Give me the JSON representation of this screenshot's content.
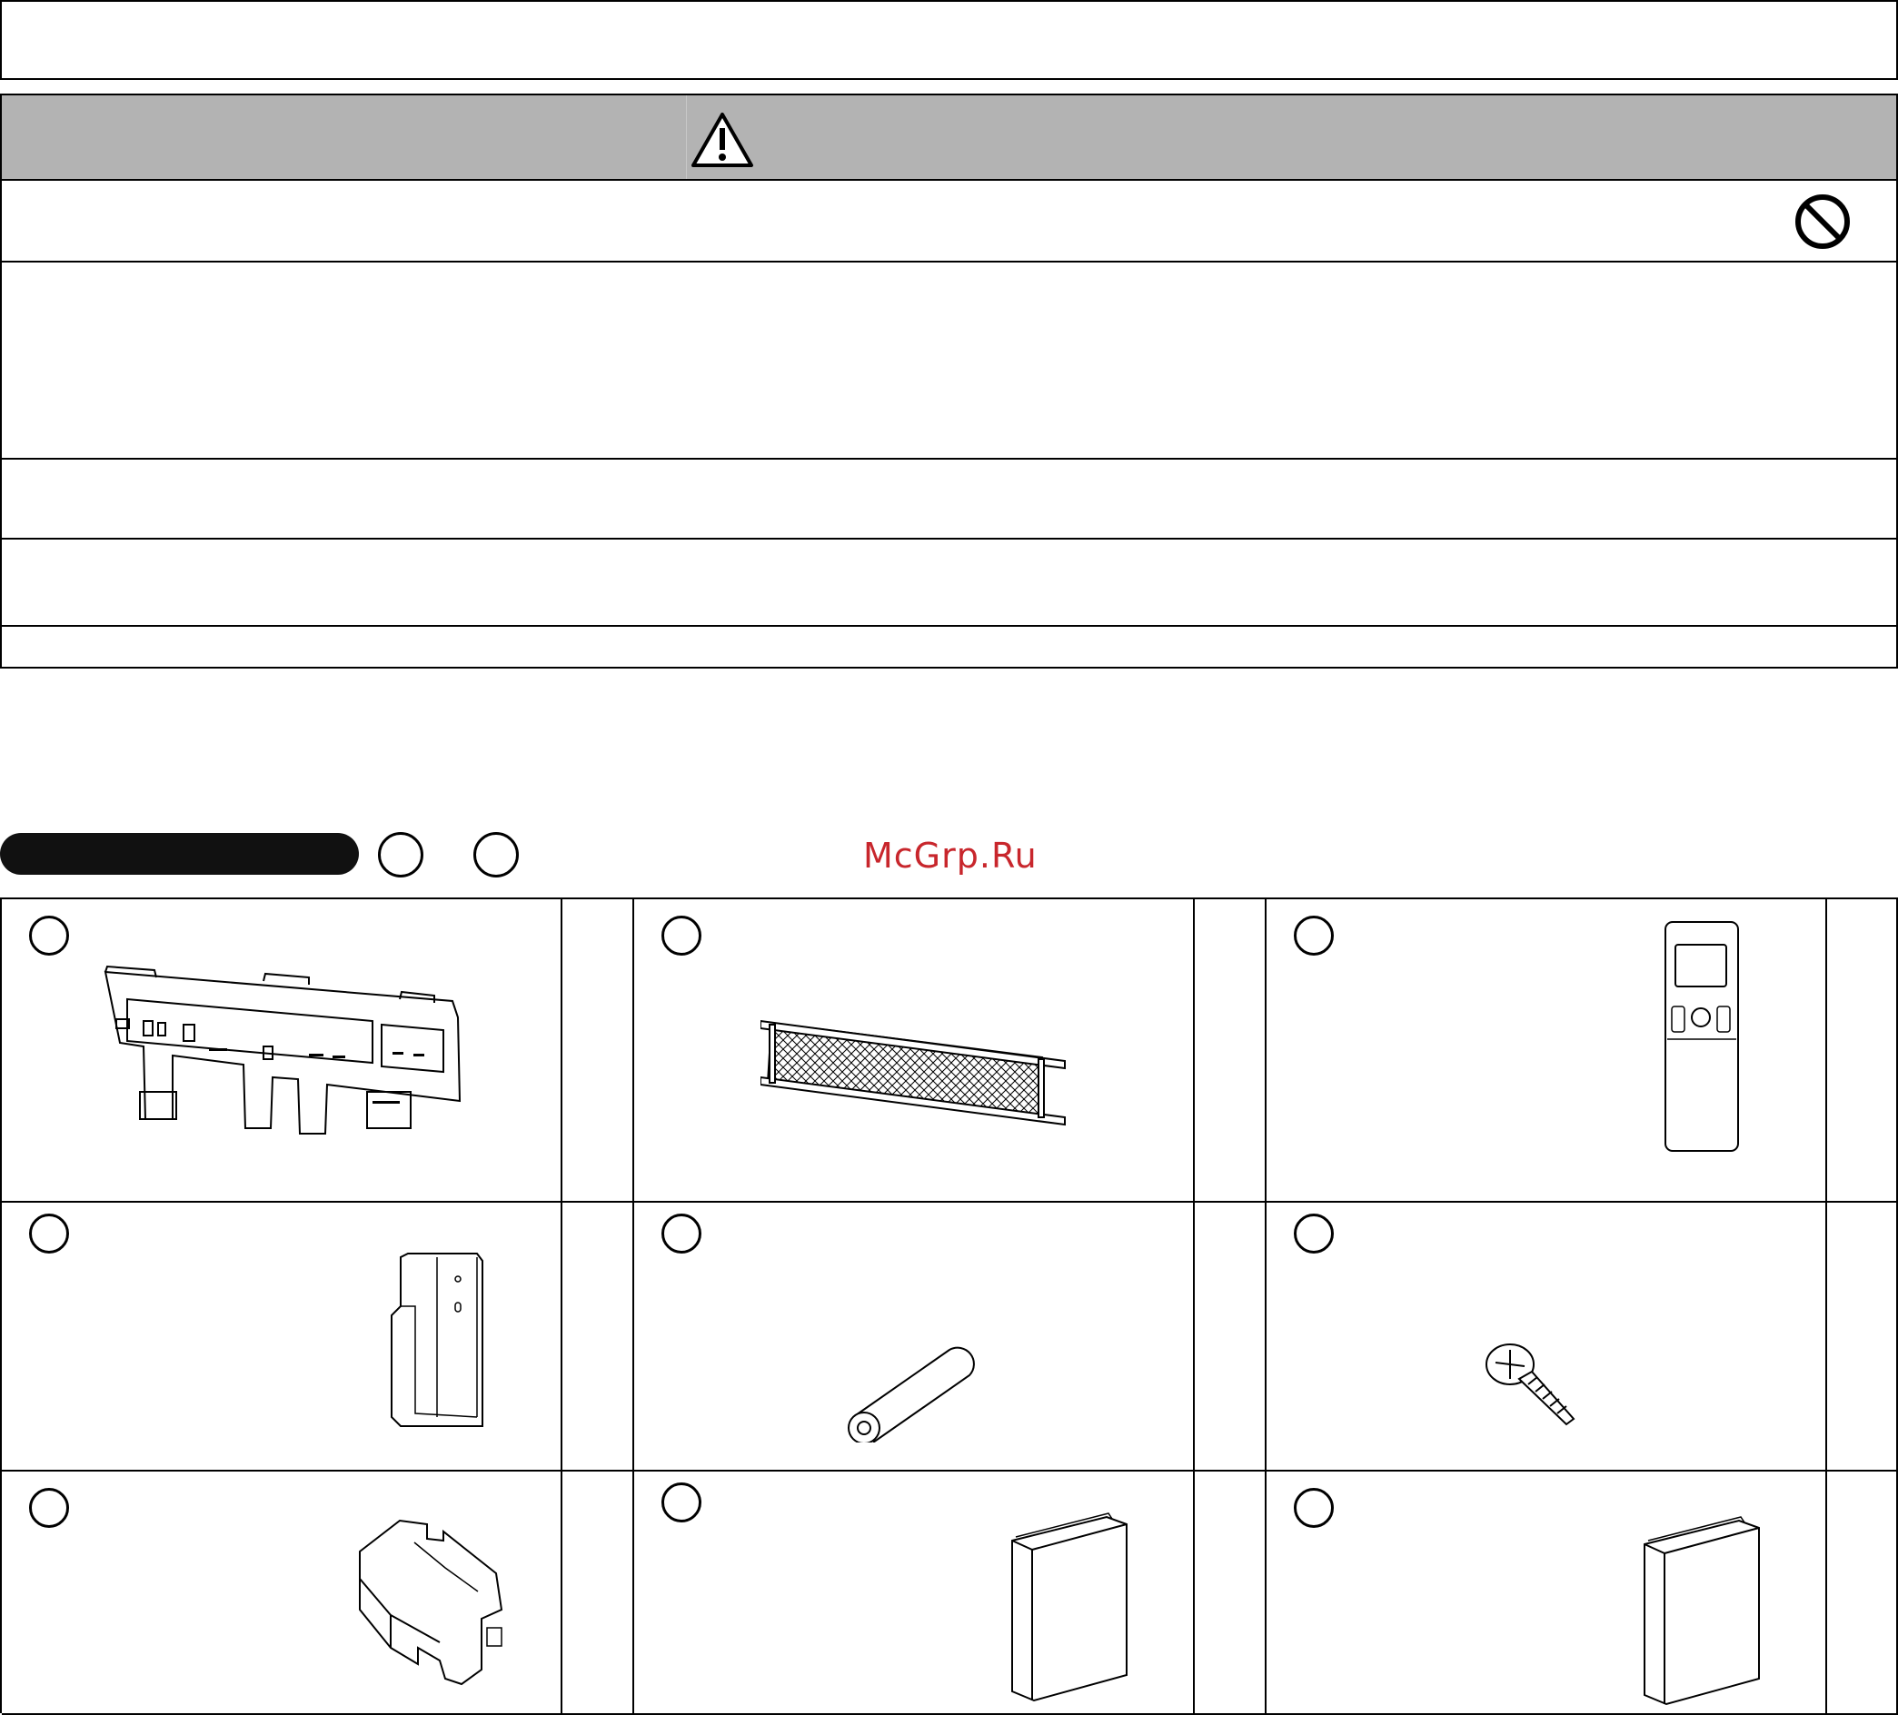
{
  "watermark": "McGrp.Ru",
  "icons": {
    "warning": "warning-triangle-icon",
    "prohibit": "prohibition-icon"
  },
  "accessories": [
    {
      "item": "wall-mounting-plate"
    },
    {
      "item": "air-filter"
    },
    {
      "item": "remote-control"
    },
    {
      "item": "remote-control-holder"
    },
    {
      "item": "battery"
    },
    {
      "item": "screw"
    },
    {
      "item": "clip"
    },
    {
      "item": "manual-book-1"
    },
    {
      "item": "manual-book-2"
    }
  ],
  "colors": {
    "header_gray": "#b3b3b3",
    "watermark_red": "#c8262c"
  }
}
